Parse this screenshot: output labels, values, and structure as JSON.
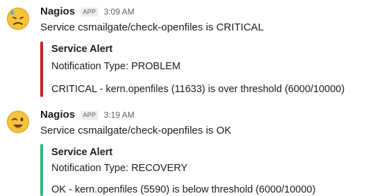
{
  "messages": [
    {
      "sender": "Nagios",
      "badge": "APP",
      "time": "3:09 AM",
      "text": "Service csmailgate/check-openfiles is CRITICAL",
      "avatar_icon": "sad-sweat-emoji-icon",
      "attachment": {
        "color": "#cc1e1e",
        "title": "Service Alert",
        "notification": "Notification Type: PROBLEM",
        "detail": "CRITICAL - kern.openfiles (11633) is over threshold (6000/10000)"
      }
    },
    {
      "sender": "Nagios",
      "badge": "APP",
      "time": "3:19 AM",
      "text": "Service csmailgate/check-openfiles is OK",
      "avatar_icon": "wink-emoji-icon",
      "attachment": {
        "color": "#2eb67d",
        "title": "Service Alert",
        "notification": "Notification Type: RECOVERY",
        "detail": "OK - kern.openfiles (5590) is below threshold (6000/10000)"
      }
    }
  ],
  "colors": {
    "emoji_face": "#f7c23b",
    "emoji_outline": "#d99a1a",
    "sweat_drop": "#5aa9e6"
  }
}
